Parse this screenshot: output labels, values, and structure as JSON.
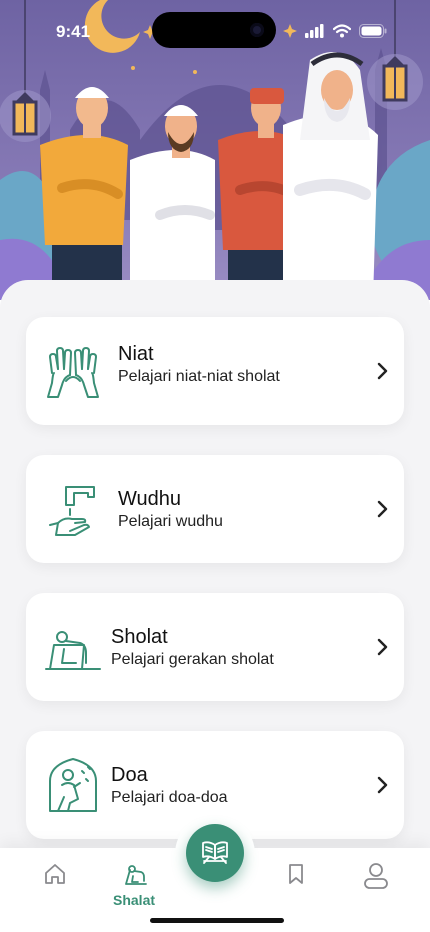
{
  "status_bar": {
    "time": "9:41"
  },
  "menu": [
    {
      "id": "niat",
      "title": "Niat",
      "subtitle": "Pelajari niat-niat sholat",
      "icon": "praying-hands-icon"
    },
    {
      "id": "wudhu",
      "title": "Wudhu",
      "subtitle": "Pelajari wudhu",
      "icon": "water-tap-icon"
    },
    {
      "id": "sholat",
      "title": "Sholat",
      "subtitle": "Pelajari gerakan sholat",
      "icon": "prostration-icon"
    },
    {
      "id": "doa",
      "title": "Doa",
      "subtitle": "Pelajari doa-doa",
      "icon": "person-praying-icon"
    }
  ],
  "nav": {
    "items": [
      {
        "id": "home",
        "icon": "home-icon"
      },
      {
        "id": "shalat",
        "icon": "shalat-icon",
        "label": "Shalat",
        "active": true
      },
      {
        "id": "quran",
        "icon": "quran-icon"
      },
      {
        "id": "bookmark",
        "icon": "bookmark-icon"
      },
      {
        "id": "profile",
        "icon": "profile-icon"
      }
    ]
  },
  "colors": {
    "accent": "#3a8f76",
    "hero_bg": "#7a6eae",
    "sheet_bg": "#f4f4f6"
  }
}
